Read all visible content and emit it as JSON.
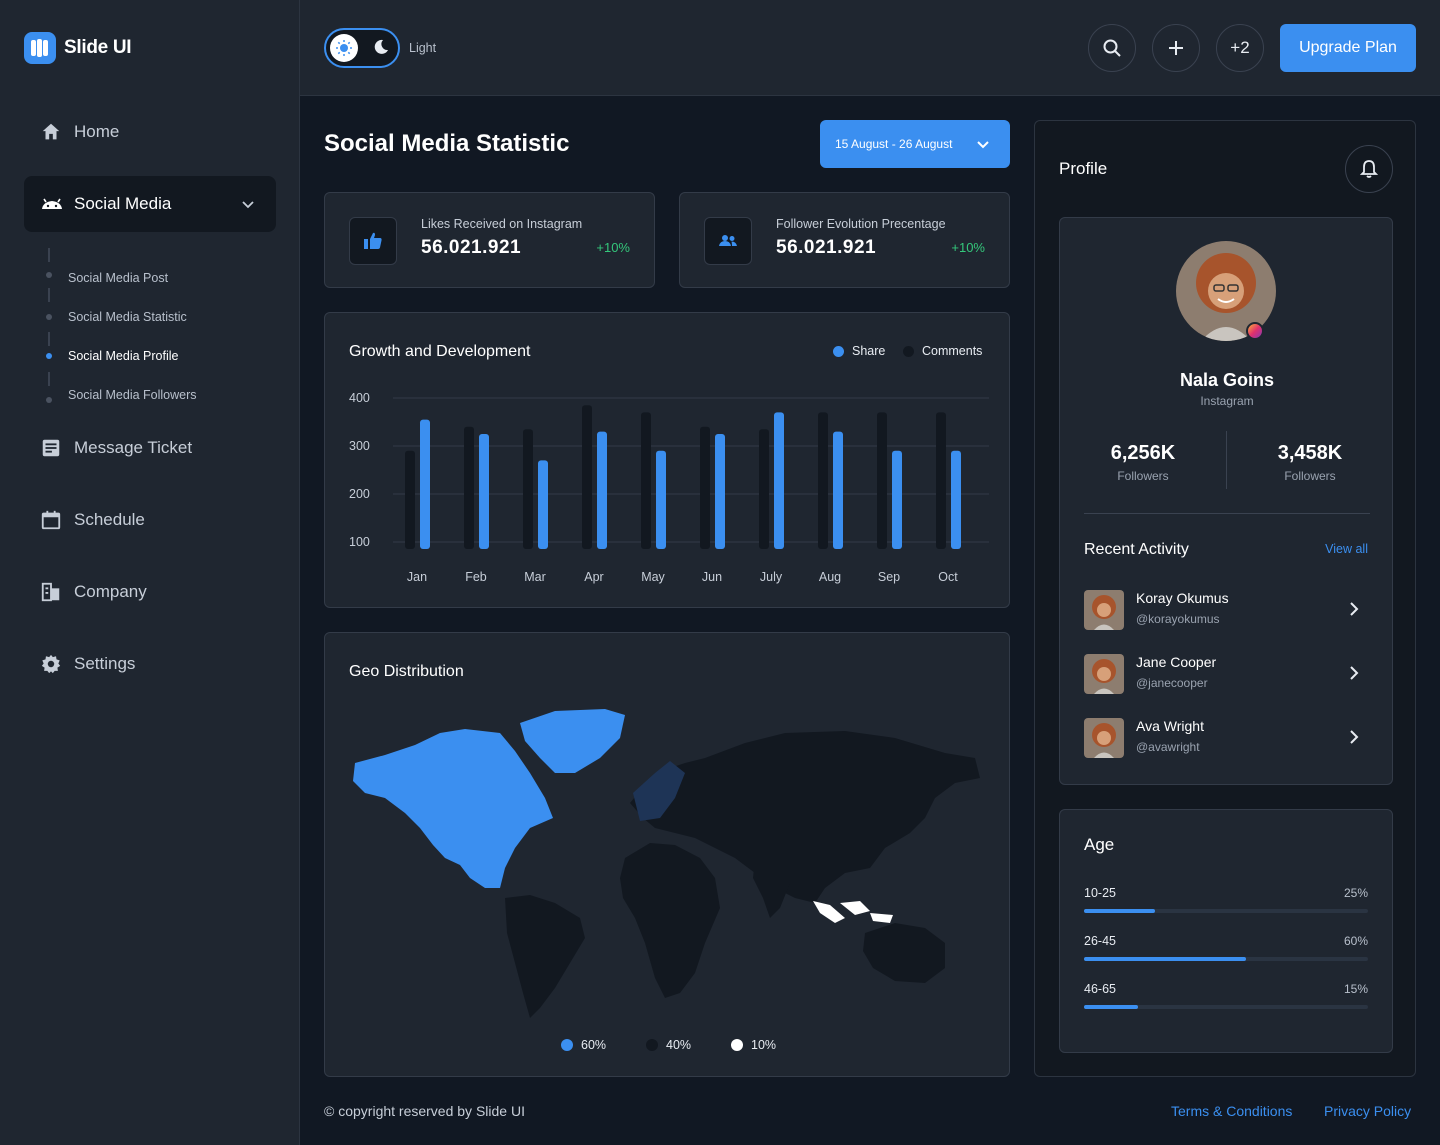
{
  "brand": {
    "name": "Slide UI"
  },
  "sidebar": {
    "items": [
      {
        "label": "Home",
        "icon": "home-icon"
      },
      {
        "label": "Social Media",
        "icon": "android-icon"
      },
      {
        "label": "Message Ticket",
        "icon": "ticket-icon"
      },
      {
        "label": "Schedule",
        "icon": "calendar-icon"
      },
      {
        "label": "Company",
        "icon": "building-icon"
      },
      {
        "label": "Settings",
        "icon": "gear-icon"
      }
    ],
    "sub_items": [
      {
        "label": "Social Media Post",
        "active": false
      },
      {
        "label": "Social Media Statistic",
        "active": false
      },
      {
        "label": "Social Media Profile",
        "active": true
      },
      {
        "label": "Social Media Followers",
        "active": false
      }
    ]
  },
  "topbar": {
    "theme_label": "Light",
    "extra_count": "+2",
    "upgrade_label": "Upgrade Plan"
  },
  "main": {
    "title": "Social Media Statistic",
    "date_range": "15 August - 26 August",
    "stats": [
      {
        "label": "Likes Received on Instagram",
        "value": "56.021.921",
        "change": "+10%",
        "icon": "thumbs-up-icon"
      },
      {
        "label": "Follower Evolution Precentage",
        "value": "56.021.921",
        "change": "+10%",
        "icon": "users-icon"
      }
    ]
  },
  "chart_data": {
    "type": "bar",
    "title": "Growth and Development",
    "categories": [
      "Jan",
      "Feb",
      "Mar",
      "Apr",
      "May",
      "Jun",
      "July",
      "Aug",
      "Sep",
      "Oct"
    ],
    "series": [
      {
        "name": "Comments",
        "color": "#121820",
        "values": [
          290,
          340,
          335,
          385,
          370,
          340,
          335,
          370,
          370,
          370
        ]
      },
      {
        "name": "Share",
        "color": "#3b8ff0",
        "values": [
          355,
          325,
          270,
          330,
          290,
          325,
          370,
          330,
          290,
          290
        ]
      }
    ],
    "yticks": [
      "400",
      "300",
      "200",
      "100"
    ],
    "ylim": [
      0,
      400
    ],
    "legend": "top-right",
    "grid": true
  },
  "geo": {
    "title": "Geo Distribution",
    "legend": [
      {
        "label": "60%",
        "color": "#3b8ff0"
      },
      {
        "label": "40%",
        "color": "#121820"
      },
      {
        "label": "10%",
        "color": "#ffffff"
      }
    ]
  },
  "profile": {
    "title": "Profile",
    "name": "Nala Goins",
    "platform": "Instagram",
    "stats": [
      {
        "value": "6,256K",
        "label": "Followers"
      },
      {
        "value": "3,458K",
        "label": "Followers"
      }
    ],
    "recent_title": "Recent Activity",
    "view_all": "View all",
    "activity": [
      {
        "name": "Koray Okumus",
        "handle": "@korayokumus"
      },
      {
        "name": "Jane Cooper",
        "handle": "@janecooper"
      },
      {
        "name": "Ava Wright",
        "handle": "@avawright"
      }
    ]
  },
  "age": {
    "title": "Age",
    "groups": [
      {
        "range": "10-25",
        "pct": "25%",
        "fill": 0.25
      },
      {
        "range": "26-45",
        "pct": "60%",
        "fill": 0.57
      },
      {
        "range": "46-65",
        "pct": "15%",
        "fill": 0.19
      }
    ]
  },
  "footer": {
    "copyright": "copyright reserved by Slide UI",
    "terms": "Terms & Conditions",
    "privacy": "Privacy Policy"
  }
}
